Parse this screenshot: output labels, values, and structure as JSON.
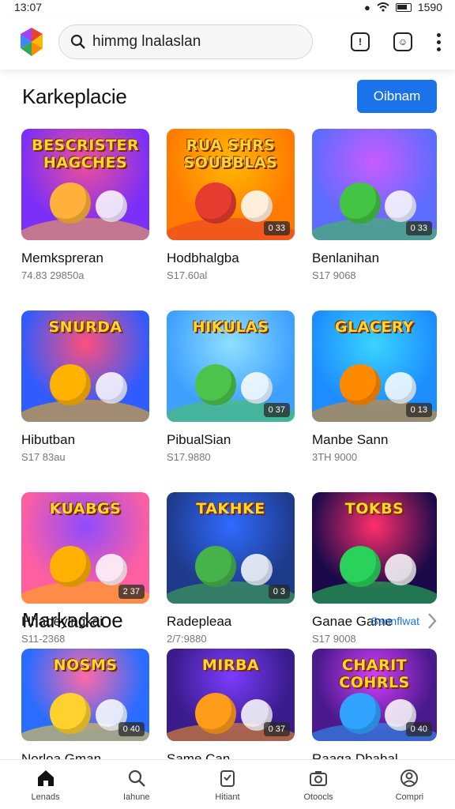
{
  "status": {
    "time": "13:07",
    "battery": "1590"
  },
  "search": {
    "query": "himmg lnalaslan"
  },
  "sections": [
    {
      "title": "Karkeplacie",
      "action_label": "Oibnam"
    },
    {
      "title": "Markadaoe",
      "action_label": "Sannflwat"
    }
  ],
  "games": [
    {
      "name": "Memkspreran",
      "meta": "74.83 29850a",
      "thumb_title": "BESCRISTER HAGCHES",
      "badge": "",
      "colors": [
        "#7b2ff7",
        "#f04e98",
        "#ffb13b"
      ]
    },
    {
      "name": "Hodbhalgba",
      "meta": "S17.60al",
      "thumb_title": "RUA SHRS SOUBBLAS",
      "badge": "0 33",
      "colors": [
        "#ff7a00",
        "#ffb800",
        "#e63c2f"
      ]
    },
    {
      "name": "Benlanihan",
      "meta": "S17 9068",
      "thumb_title": "",
      "badge": "0 33",
      "colors": [
        "#5b6cff",
        "#c85cff",
        "#43c443"
      ]
    },
    {
      "name": "Hibutban",
      "meta": "S17 83au",
      "thumb_title": "SNURDA",
      "badge": "",
      "colors": [
        "#2f5bff",
        "#ff4f7b",
        "#ffb300"
      ]
    },
    {
      "name": "PibualSian",
      "meta": "S17.9880",
      "thumb_title": "HIKULAS",
      "badge": "0 37",
      "colors": [
        "#3fa0ff",
        "#8ee0ff",
        "#4cc44c"
      ]
    },
    {
      "name": "Manbe Sann",
      "meta": "3TH 9000",
      "thumb_title": "GLACERY",
      "badge": "0 13",
      "colors": [
        "#1c8cff",
        "#3ad4ff",
        "#ff8a00"
      ]
    },
    {
      "name": "Hhabeylngkai",
      "meta": "S11-2368",
      "thumb_title": "KUABGS",
      "badge": "2 37",
      "colors": [
        "#ff5fa0",
        "#8f4bff",
        "#ffb000"
      ]
    },
    {
      "name": "Radepleaa",
      "meta": "2/7:9880",
      "thumb_title": "TAKHKE",
      "badge": "0 3",
      "colors": [
        "#1e3a8a",
        "#2f6bff",
        "#46b34a"
      ]
    },
    {
      "name": "Ganae Game",
      "meta": "S17 9008",
      "thumb_title": "TOKBS",
      "badge": "",
      "colors": [
        "#1a0a4a",
        "#ff2f6d",
        "#2ad15a"
      ]
    },
    {
      "name": "Norloa Gman",
      "meta": "",
      "thumb_title": "NOSMS",
      "badge": "0 40",
      "colors": [
        "#2a6cff",
        "#ff6aa8",
        "#ffd12e"
      ]
    },
    {
      "name": "Same Can",
      "meta": "",
      "thumb_title": "MIRBA",
      "badge": "0 37",
      "colors": [
        "#3b1c8c",
        "#7a3cff",
        "#ff9c1a"
      ]
    },
    {
      "name": "Raaga Dbabal",
      "meta": "",
      "thumb_title": "CHARIT COHRLS",
      "badge": "0 40",
      "colors": [
        "#4a1a8c",
        "#d63cff",
        "#2fa3ff"
      ]
    }
  ],
  "nav": [
    {
      "label": "Lenads",
      "icon": "home-icon",
      "active": true
    },
    {
      "label": "Iahune",
      "icon": "search-icon",
      "active": false
    },
    {
      "label": "Hitiant",
      "icon": "library-icon",
      "active": false
    },
    {
      "label": "Otoocls",
      "icon": "camera-icon",
      "active": false
    },
    {
      "label": "Compri",
      "icon": "profile-icon",
      "active": false
    }
  ],
  "accent_color": "#1a73e8"
}
